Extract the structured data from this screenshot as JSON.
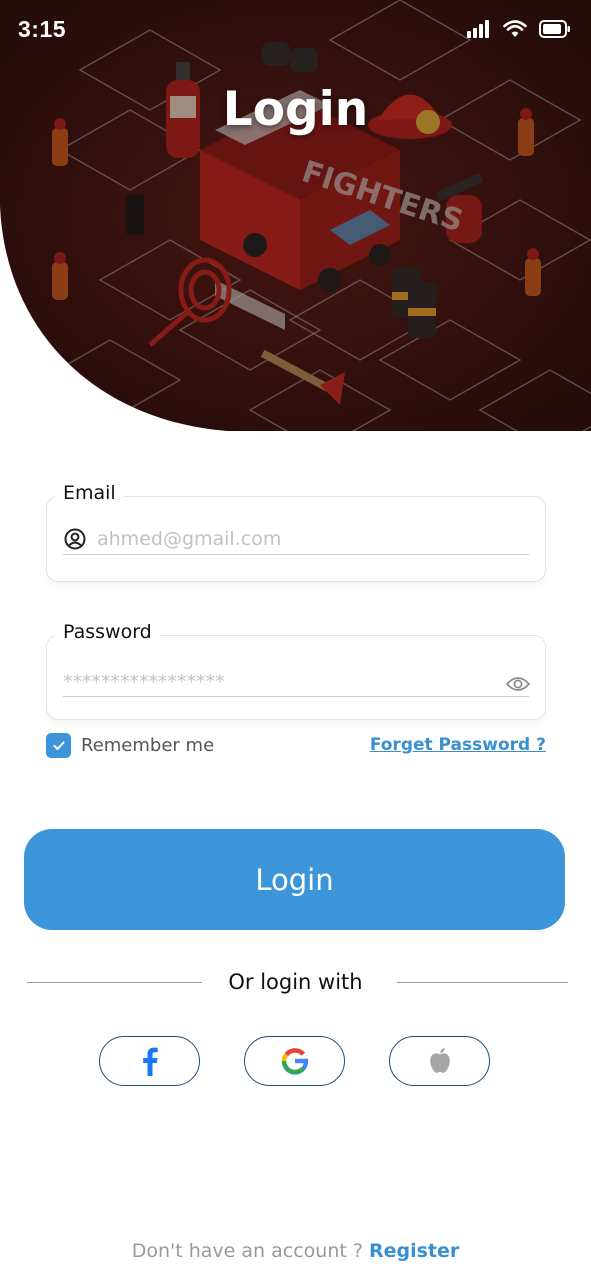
{
  "status_bar": {
    "time": "3:15",
    "icons": [
      "cellular-signal-icon",
      "wifi-icon",
      "battery-icon"
    ]
  },
  "hero": {
    "title": "Login",
    "illustration": "firefighters-isometric-illustration",
    "background_color": "#3a1512"
  },
  "form": {
    "email": {
      "label": "Email",
      "placeholder": "ahmed@gmail.com",
      "value": "",
      "icon": "user-circle-icon"
    },
    "password": {
      "label": "Password",
      "placeholder": "*****************",
      "value": "",
      "icon": "eye-icon"
    },
    "remember_me": {
      "label": "Remember me",
      "checked": true
    },
    "forget_password": "Forget Password ?"
  },
  "actions": {
    "login_label": "Login",
    "divider_text": "Or login with",
    "social": [
      "facebook-icon",
      "google-icon",
      "apple-icon"
    ]
  },
  "footer": {
    "text": "Don't have an account ? ",
    "register_label": "Register"
  },
  "colors": {
    "primary": "#3b95d8",
    "link": "#3a8fd1",
    "social_border": "#1e4d7a",
    "facebook": "#1877f2"
  }
}
